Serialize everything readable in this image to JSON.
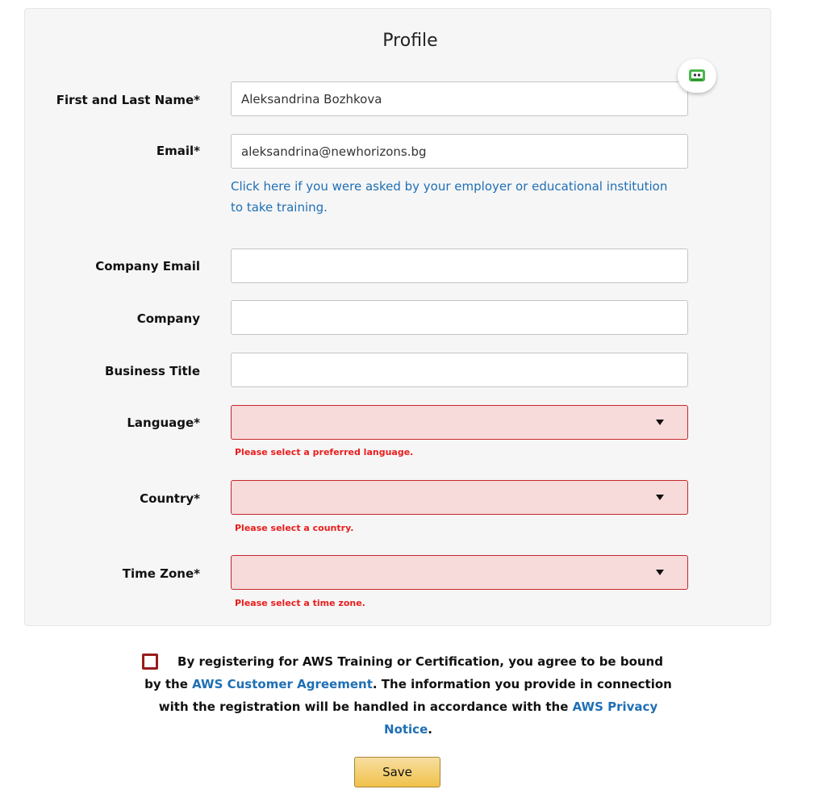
{
  "profile": {
    "title": "Profile",
    "fields": {
      "name": {
        "label": "First and Last Name*",
        "value": "Aleksandrina Bozhkova"
      },
      "email": {
        "label": "Email*",
        "value": "aleksandrina@newhorizons.bg"
      },
      "company_email": {
        "label": "Company Email",
        "value": ""
      },
      "company": {
        "label": "Company",
        "value": ""
      },
      "business_title": {
        "label": "Business Title",
        "value": ""
      },
      "language": {
        "label": "Language*",
        "value": "",
        "error": "Please select a preferred language."
      },
      "country": {
        "label": "Country*",
        "value": "",
        "error": "Please select a country."
      },
      "time_zone": {
        "label": "Time Zone*",
        "value": "",
        "error": "Please select a time zone."
      }
    },
    "employer_link": "Click here if you were asked by your employer or educational institution to take training."
  },
  "agreement": {
    "text_1": "By registering for AWS Training or Certification, you agree to be bound by the ",
    "link_1": "AWS Customer Agreement",
    "text_2": ". The information you provide in connection with the registration will be handled in accordance with the ",
    "link_2": "AWS Privacy Notice",
    "text_3": "."
  },
  "save_label": "Save",
  "colors": {
    "link": "#1f6fb5",
    "error_text": "#ea1d1d",
    "error_border": "#c4292b",
    "error_bg": "#f7dada",
    "save_button": "#f0c14b"
  },
  "icons": {
    "extension_badge": "robot-face-icon"
  }
}
